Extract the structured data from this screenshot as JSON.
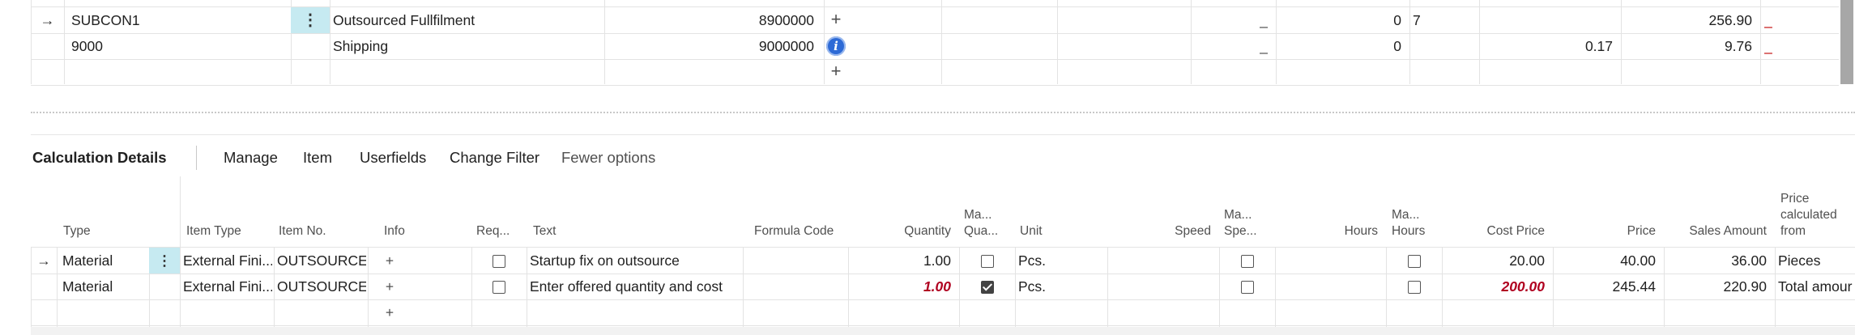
{
  "top_grid": {
    "rows": [
      {
        "selected": true,
        "no": "SUBCON1",
        "description": "Outsourced Fullfilment",
        "code": "8900000",
        "icon": "plus-icon",
        "dash1": "_",
        "qty": "0",
        "col_b": "7",
        "unit_price": "",
        "amount": "256.90",
        "dash2": "_"
      },
      {
        "selected": false,
        "no": "9000",
        "description": "Shipping",
        "code": "9000000",
        "icon": "info-icon",
        "dash1": "_",
        "qty": "0",
        "col_b": "",
        "unit_price": "0.17",
        "amount": "9.76",
        "dash2": "_"
      }
    ],
    "new_line_icon": "plus-icon"
  },
  "section": {
    "title": "Calculation Details",
    "actions": {
      "manage": "Manage",
      "item": "Item",
      "userfields": "Userfields",
      "change_filter": "Change Filter",
      "fewer_options": "Fewer options"
    }
  },
  "calc_grid": {
    "headers": {
      "type": "Type",
      "item_type": "Item Type",
      "item_no": "Item No.",
      "info": "Info",
      "req": "Req...",
      "text": "Text",
      "formula_code": "Formula Code",
      "quantity": "Quantity",
      "man_qty_1": "Ma...",
      "man_qty_2": "Qua...",
      "unit": "Unit",
      "speed": "Speed",
      "man_speed_1": "Ma...",
      "man_speed_2": "Spe...",
      "hours": "Hours",
      "man_hours_1": "Ma...",
      "man_hours_2": "Hours",
      "cost_price": "Cost Price",
      "price": "Price",
      "sales_amount": "Sales Amount",
      "price_calc_1": "Price",
      "price_calc_2": "calculated",
      "price_calc_3": "from"
    },
    "rows": [
      {
        "selected": true,
        "type": "Material",
        "item_type": "External Fini...",
        "item_no": "OUTSOURCES...",
        "info_icon": "plus-icon",
        "req": false,
        "text": "Startup fix on outsource",
        "formula_code": "",
        "quantity": "1.00",
        "quantity_manual": false,
        "man_qty": false,
        "unit": "Pcs.",
        "speed": "",
        "man_speed": false,
        "hours": "",
        "man_hours": false,
        "cost_price": "20.00",
        "cost_price_manual": false,
        "price": "40.00",
        "sales_amount": "36.00",
        "price_calculated_from": "Pieces"
      },
      {
        "selected": false,
        "type": "Material",
        "item_type": "External Fini...",
        "item_no": "OUTSOURCE",
        "info_icon": "plus-icon",
        "req": false,
        "text": "Enter offered quantity and cost",
        "formula_code": "",
        "quantity": "1.00",
        "quantity_manual": true,
        "man_qty": true,
        "unit": "Pcs.",
        "speed": "",
        "man_speed": false,
        "hours": "",
        "man_hours": false,
        "cost_price": "200.00",
        "cost_price_manual": true,
        "price": "245.44",
        "sales_amount": "220.90",
        "price_calculated_from": "Total amour"
      }
    ],
    "new_line_icon": "plus-icon"
  },
  "colors": {
    "selection": "#c6eaf1",
    "manual_value": "#b00020",
    "info": "#2d6ad6"
  }
}
